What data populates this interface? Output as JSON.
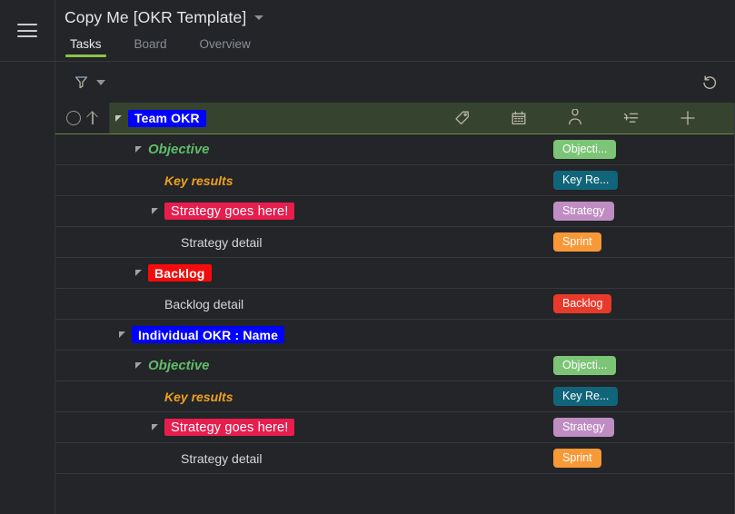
{
  "app": {
    "title": "Copy Me [OKR Template]",
    "menu_icon": "hamburger-icon",
    "title_caret": "chevron-down-icon"
  },
  "tabs": [
    {
      "label": "Tasks",
      "active": true
    },
    {
      "label": "Board",
      "active": false
    },
    {
      "label": "Overview",
      "active": false
    }
  ],
  "toolbar": {
    "filter_icon": "filter-funnel-icon",
    "filter_caret": "chevron-down-icon",
    "undo_icon": "undo-rotate-left-icon"
  },
  "group_row_icons": [
    {
      "name": "tag-icon"
    },
    {
      "name": "calendar-icon"
    },
    {
      "name": "person-icon"
    },
    {
      "name": "list-add-icon"
    },
    {
      "name": "plus-icon"
    }
  ],
  "gutter": {
    "status_circle": "circle-status-icon",
    "up_arrow": "arrow-up-icon"
  },
  "colors": {
    "accent_green": "#8bc34a",
    "group_row_bg": "#36432e",
    "group_row_border": "#6d8a4f",
    "page_bg": "#232528",
    "divider": "#34373b",
    "badge_objective": "#7cc576",
    "badge_keyresults": "#11657a",
    "badge_strategy": "#bf8dc4",
    "badge_sprint": "#f89938",
    "badge_backlog": "#e8392a",
    "hl_blue": "#0000ff",
    "hl_red": "#f40c0c",
    "hl_crimson": "#e71d4d",
    "text_objective": "#5fbd6a",
    "text_keyresults": "#f0a01e"
  },
  "rows": [
    {
      "id": "team-okr",
      "kind": "group",
      "indent": 0,
      "toggle": true,
      "gutter": true,
      "label": "Team OKR",
      "label_style": "hl-blue",
      "badge": null,
      "icons": true
    },
    {
      "id": "objective-1",
      "kind": "task",
      "indent": 1,
      "toggle": true,
      "gutter": false,
      "label": "Objective",
      "label_style": "objective",
      "badge": {
        "text": "Objecti...",
        "color": "#7cc576"
      },
      "icons": false
    },
    {
      "id": "key-results-1",
      "kind": "task",
      "indent": 2,
      "toggle": false,
      "gutter": false,
      "label": "Key results",
      "label_style": "keyres",
      "badge": {
        "text": "Key Re...",
        "color": "#11657a"
      },
      "icons": false
    },
    {
      "id": "strategy-1",
      "kind": "task",
      "indent": 2,
      "toggle": true,
      "gutter": false,
      "label": "Strategy goes here!",
      "label_style": "hl-crimson",
      "badge": {
        "text": "Strategy",
        "color": "#bf8dc4"
      },
      "icons": false
    },
    {
      "id": "strategy-detail-1",
      "kind": "task",
      "indent": 3,
      "toggle": false,
      "gutter": false,
      "label": "Strategy detail",
      "label_style": "plain",
      "badge": {
        "text": "Sprint",
        "color": "#f89938"
      },
      "icons": false
    },
    {
      "id": "backlog-1",
      "kind": "task",
      "indent": 1,
      "toggle": true,
      "gutter": false,
      "label": "Backlog",
      "label_style": "hl-red",
      "badge": null,
      "icons": false
    },
    {
      "id": "backlog-detail-1",
      "kind": "task",
      "indent": 2,
      "toggle": false,
      "gutter": false,
      "label": "Backlog detail",
      "label_style": "plain",
      "badge": {
        "text": "Backlog",
        "color": "#e8392a"
      },
      "icons": false
    },
    {
      "id": "individual-okr",
      "kind": "task",
      "indent": 0,
      "toggle": true,
      "gutter": false,
      "label": "Individual OKR : Name",
      "label_style": "hl-blue",
      "badge": null,
      "icons": false
    },
    {
      "id": "objective-2",
      "kind": "task",
      "indent": 1,
      "toggle": true,
      "gutter": false,
      "label": "Objective",
      "label_style": "objective",
      "badge": {
        "text": "Objecti...",
        "color": "#7cc576"
      },
      "icons": false
    },
    {
      "id": "key-results-2",
      "kind": "task",
      "indent": 2,
      "toggle": false,
      "gutter": false,
      "label": "Key results",
      "label_style": "keyres",
      "badge": {
        "text": "Key Re...",
        "color": "#11657a"
      },
      "icons": false
    },
    {
      "id": "strategy-2",
      "kind": "task",
      "indent": 2,
      "toggle": true,
      "gutter": false,
      "label": "Strategy goes here!",
      "label_style": "hl-crimson",
      "badge": {
        "text": "Strategy",
        "color": "#bf8dc4"
      },
      "icons": false
    },
    {
      "id": "strategy-detail-2",
      "kind": "task",
      "indent": 3,
      "toggle": false,
      "gutter": false,
      "label": "Strategy detail",
      "label_style": "plain",
      "badge": {
        "text": "Sprint",
        "color": "#f89938"
      },
      "icons": false
    }
  ]
}
